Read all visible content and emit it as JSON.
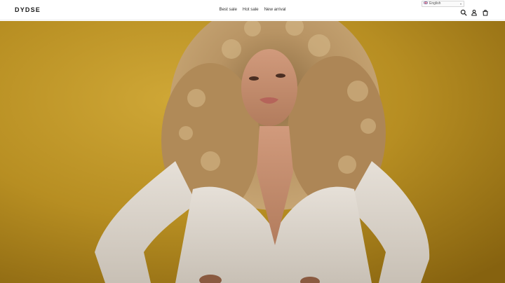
{
  "header": {
    "logo": "DYDSE",
    "nav": [
      {
        "label": "Best sale"
      },
      {
        "label": "Hot sale"
      },
      {
        "label": "New arrival"
      }
    ],
    "language": {
      "selected": "English"
    },
    "icons": [
      "search-icon",
      "account-icon",
      "cart-icon"
    ]
  },
  "hero": {
    "image": "portrait-woman-curly-hair-yellow-background",
    "background_color": "#b88f22"
  }
}
